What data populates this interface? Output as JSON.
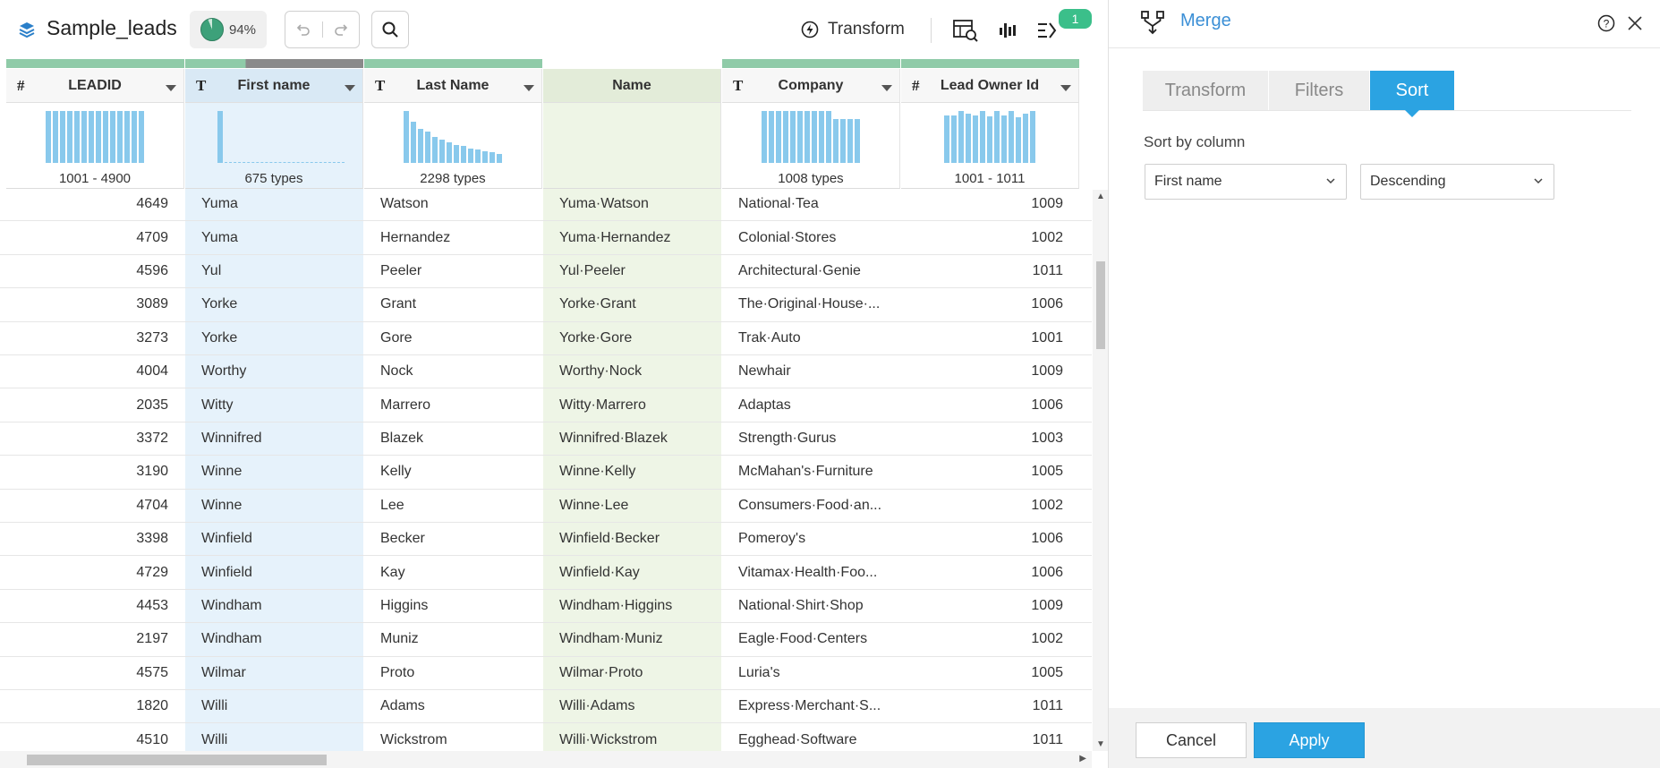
{
  "toolbar": {
    "dataset_name": "Sample_leads",
    "quality_percent": "94%",
    "transform_label": "Transform",
    "badge_count": "1"
  },
  "columns": [
    {
      "key": "leadid",
      "label": "LEADID",
      "type_icon": "#",
      "summary": "1001 - 4900",
      "quality_color": "#8fcba8"
    },
    {
      "key": "first",
      "label": "First name",
      "type_icon": "T",
      "summary": "675 types",
      "quality_color": "#8fcba8"
    },
    {
      "key": "last",
      "label": "Last Name",
      "type_icon": "T",
      "summary": "2298 types",
      "quality_color": "#8fcba8"
    },
    {
      "key": "name",
      "label": "Name",
      "type_icon": "",
      "summary": "",
      "quality_color": "#ffffff"
    },
    {
      "key": "company",
      "label": "Company",
      "type_icon": "T",
      "summary": "1008 types",
      "quality_color": "#8fcba8"
    },
    {
      "key": "owner",
      "label": "Lead Owner Id",
      "type_icon": "#",
      "summary": "1001 - 1011",
      "quality_color": "#8fcba8"
    }
  ],
  "rows": [
    {
      "leadid": "4649",
      "first": "Yuma",
      "last": "Watson",
      "name": "Yuma·Watson",
      "company": "National·Tea",
      "owner": "1009"
    },
    {
      "leadid": "4709",
      "first": "Yuma",
      "last": "Hernandez",
      "name": "Yuma·Hernandez",
      "company": "Colonial·Stores",
      "owner": "1002"
    },
    {
      "leadid": "4596",
      "first": "Yul",
      "last": "Peeler",
      "name": "Yul·Peeler",
      "company": "Architectural·Genie",
      "owner": "1011"
    },
    {
      "leadid": "3089",
      "first": "Yorke",
      "last": "Grant",
      "name": "Yorke·Grant",
      "company": "The·Original·House·...",
      "owner": "1006"
    },
    {
      "leadid": "3273",
      "first": "Yorke",
      "last": "Gore",
      "name": "Yorke·Gore",
      "company": "Trak·Auto",
      "owner": "1001"
    },
    {
      "leadid": "4004",
      "first": "Worthy",
      "last": "Nock",
      "name": "Worthy·Nock",
      "company": "Newhair",
      "owner": "1009"
    },
    {
      "leadid": "2035",
      "first": "Witty",
      "last": "Marrero",
      "name": "Witty·Marrero",
      "company": "Adaptas",
      "owner": "1006"
    },
    {
      "leadid": "3372",
      "first": "Winnifred",
      "last": "Blazek",
      "name": "Winnifred·Blazek",
      "company": "Strength·Gurus",
      "owner": "1003"
    },
    {
      "leadid": "3190",
      "first": "Winne",
      "last": "Kelly",
      "name": "Winne·Kelly",
      "company": "McMahan's·Furniture",
      "owner": "1005"
    },
    {
      "leadid": "4704",
      "first": "Winne",
      "last": "Lee",
      "name": "Winne·Lee",
      "company": "Consumers·Food·an...",
      "owner": "1002"
    },
    {
      "leadid": "3398",
      "first": "Winfield",
      "last": "Becker",
      "name": "Winfield·Becker",
      "company": "Pomeroy's",
      "owner": "1006"
    },
    {
      "leadid": "4729",
      "first": "Winfield",
      "last": "Kay",
      "name": "Winfield·Kay",
      "company": "Vitamax·Health·Foo...",
      "owner": "1006"
    },
    {
      "leadid": "4453",
      "first": "Windham",
      "last": "Higgins",
      "name": "Windham·Higgins",
      "company": "National·Shirt·Shop",
      "owner": "1009"
    },
    {
      "leadid": "2197",
      "first": "Windham",
      "last": "Muniz",
      "name": "Windham·Muniz",
      "company": "Eagle·Food·Centers",
      "owner": "1002"
    },
    {
      "leadid": "4575",
      "first": "Wilmar",
      "last": "Proto",
      "name": "Wilmar·Proto",
      "company": "Luria's",
      "owner": "1005"
    },
    {
      "leadid": "1820",
      "first": "Willi",
      "last": "Adams",
      "name": "Willi·Adams",
      "company": "Express·Merchant·S...",
      "owner": "1011"
    },
    {
      "leadid": "4510",
      "first": "Willi",
      "last": "Wickstrom",
      "name": "Willi·Wickstrom",
      "company": "Egghead·Software",
      "owner": "1011"
    }
  ],
  "histograms": {
    "leadid": [
      1,
      1,
      1,
      1,
      1,
      1,
      1,
      1,
      1,
      1,
      1,
      1,
      1,
      1
    ],
    "first": [
      1,
      0.02,
      0.02,
      0.02,
      0.02,
      0.02,
      0.02,
      0.02,
      0.02,
      0.02,
      0.02,
      0.02,
      0.02
    ],
    "last": [
      1,
      0.8,
      0.65,
      0.6,
      0.5,
      0.45,
      0.4,
      0.35,
      0.32,
      0.28,
      0.25,
      0.22,
      0.2,
      0.18
    ],
    "company": [
      1,
      1,
      1,
      1,
      1,
      1,
      1,
      1,
      1,
      1,
      0.85,
      0.85,
      0.85,
      0.85
    ],
    "owner": [
      0.92,
      0.92,
      1,
      0.95,
      0.92,
      1,
      0.9,
      1,
      0.92,
      1,
      0.88,
      0.94,
      1
    ]
  },
  "panel": {
    "title": "Merge",
    "tabs": [
      "Transform",
      "Filters",
      "Sort"
    ],
    "active_tab": "Sort",
    "sort_by_label": "Sort by column",
    "sort_column": "First name",
    "sort_order": "Descending",
    "cancel_label": "Cancel",
    "apply_label": "Apply"
  },
  "colors": {
    "accent": "#2ba3e2",
    "title_blue": "#3b8fd6",
    "quality_green": "#3da17a",
    "badge_green": "#3bbf8a",
    "histogram": "#89c9ec"
  }
}
